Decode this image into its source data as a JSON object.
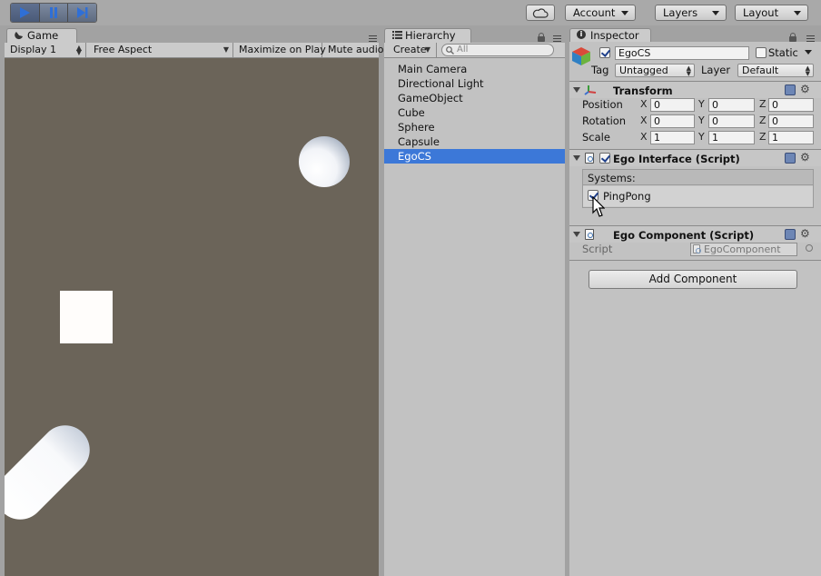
{
  "toolbar": {
    "account_label": "Account",
    "layers_label": "Layers",
    "layout_label": "Layout",
    "icons": [
      "play-icon",
      "pause-icon",
      "step-icon",
      "cloud-icon"
    ]
  },
  "game_panel": {
    "tab_label": "Game",
    "display_label": "Display 1",
    "aspect_label": "Free Aspect",
    "maximize_label": "Maximize on Play",
    "mute_label": "Mute audio"
  },
  "hierarchy": {
    "tab_label": "Hierarchy",
    "create_label": "Create",
    "search_placeholder": "All",
    "items": [
      {
        "label": "Main Camera"
      },
      {
        "label": "Directional Light"
      },
      {
        "label": "GameObject"
      },
      {
        "label": "Cube"
      },
      {
        "label": "Sphere"
      },
      {
        "label": "Capsule"
      },
      {
        "label": "EgoCS",
        "selected": true
      }
    ]
  },
  "inspector": {
    "tab_label": "Inspector",
    "object_name": "EgoCS",
    "active": true,
    "static_label": "Static",
    "tag_label": "Tag",
    "tag_value": "Untagged",
    "layer_label": "Layer",
    "layer_value": "Default",
    "transform": {
      "title": "Transform",
      "rows": [
        {
          "label": "Position",
          "x": "0",
          "y": "0",
          "z": "0"
        },
        {
          "label": "Rotation",
          "x": "0",
          "y": "0",
          "z": "0"
        },
        {
          "label": "Scale",
          "x": "1",
          "y": "1",
          "z": "1"
        }
      ],
      "axis_x": "X",
      "axis_y": "Y",
      "axis_z": "Z"
    },
    "ego_interface": {
      "title": "Ego Interface (Script)",
      "enabled": true,
      "systems_label": "Systems:",
      "system_item": "PingPong",
      "system_checked": true
    },
    "ego_component": {
      "title": "Ego Component (Script)",
      "script_label": "Script",
      "script_value": "EgoComponent"
    },
    "add_component_label": "Add Component"
  }
}
